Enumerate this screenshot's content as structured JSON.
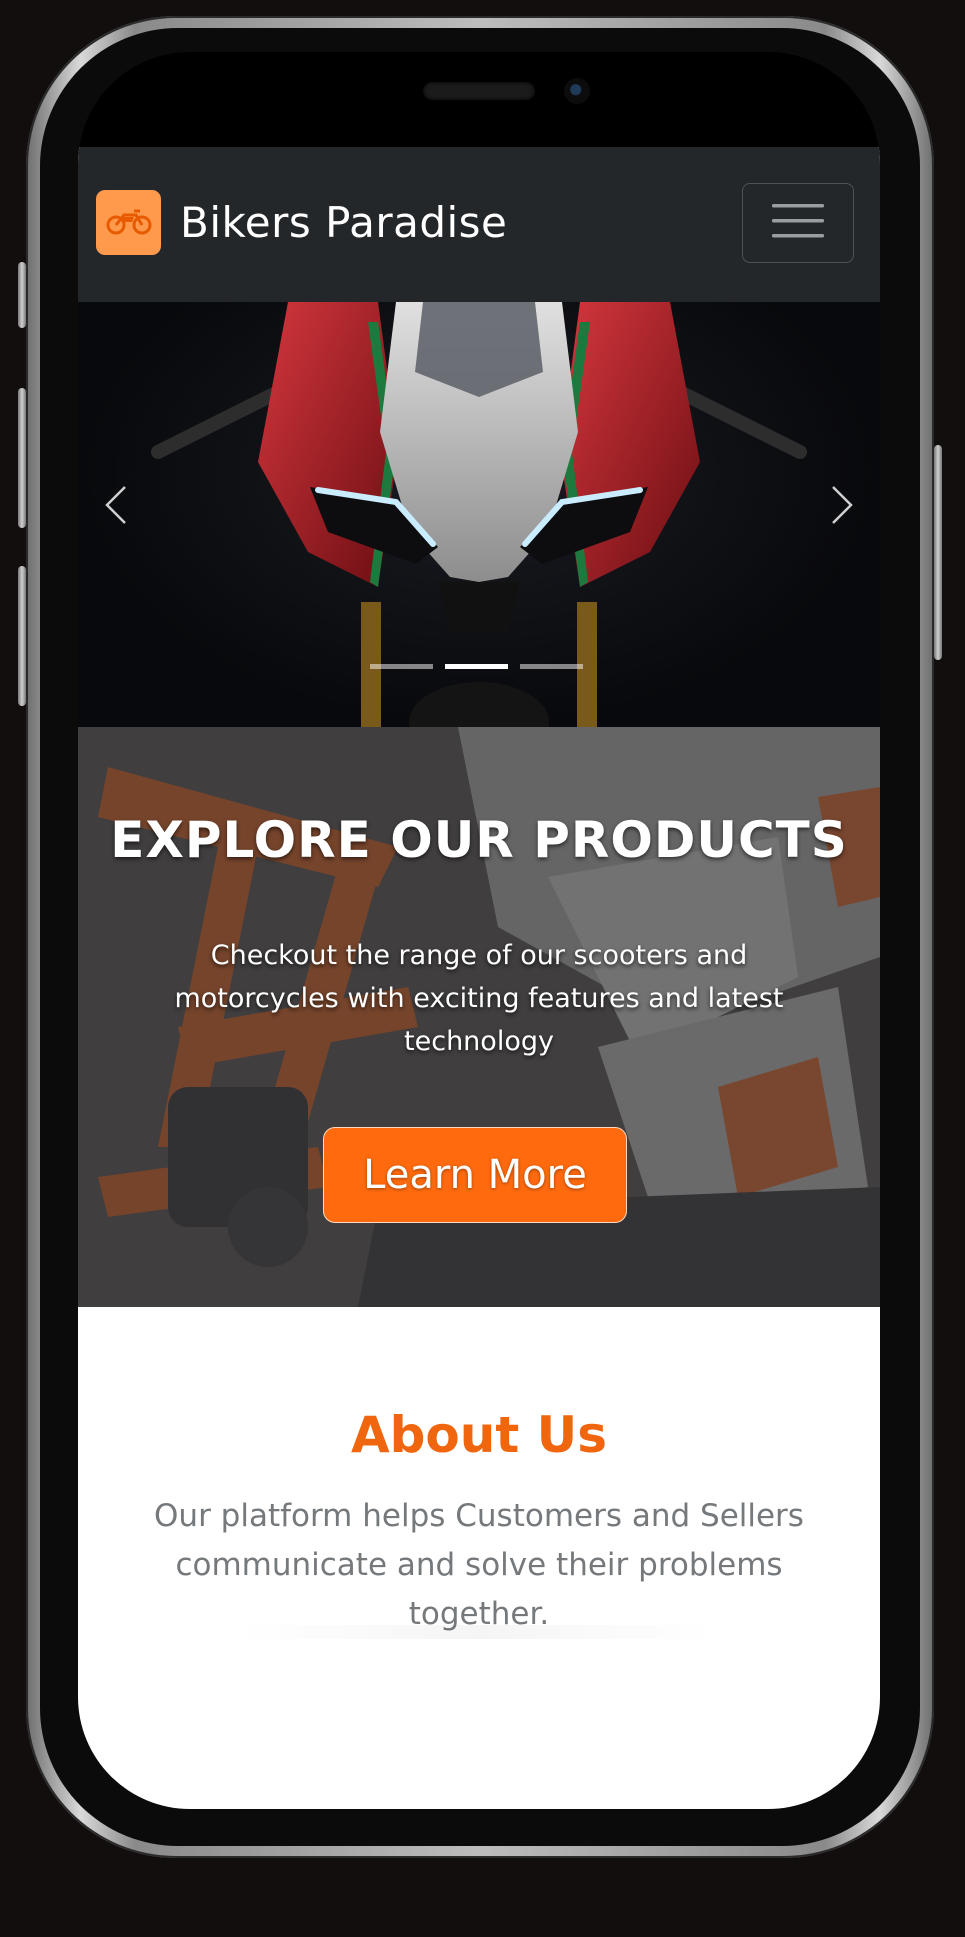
{
  "navbar": {
    "brand": "Bikers Paradise",
    "logo_icon": "motorcycle-icon",
    "menu_icon": "hamburger-menu-icon"
  },
  "carousel": {
    "prev_icon": "chevron-left-icon",
    "next_icon": "chevron-right-icon",
    "slide_count": 3,
    "active_slide": 2
  },
  "hero": {
    "title": "EXPLORE OUR PRODUCTS",
    "text": "Checkout the range of our scooters and motorcycles with exciting features and latest technology",
    "button_label": "Learn More"
  },
  "about": {
    "title": "About Us",
    "text": "Our platform helps Customers and Sellers communicate and solve their problems together."
  },
  "colors": {
    "accent": "#ff6a0e",
    "logo_bg": "#ff9a4d",
    "navbar_bg": "#24272a",
    "about_title": "#f0660f",
    "body_text": "#76797c"
  }
}
